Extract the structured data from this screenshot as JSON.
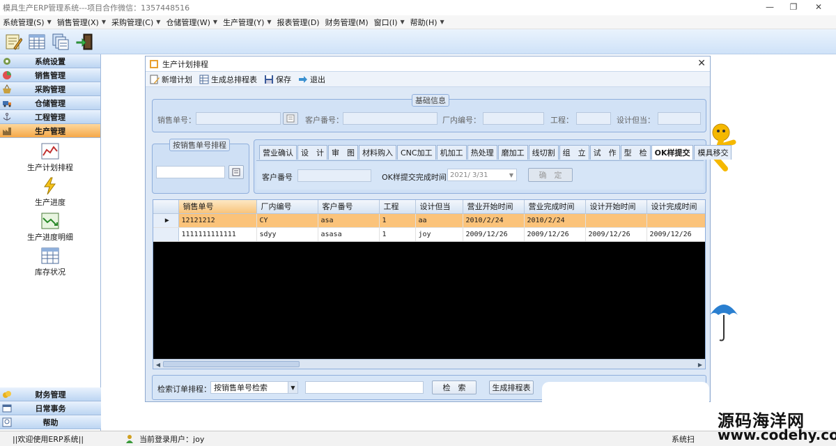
{
  "window": {
    "title": "模具生产ERP管理系统---项目合作微信：13574485​16",
    "controls": {
      "minimize": "—",
      "maximize": "❐",
      "close": "✕"
    }
  },
  "menu": [
    "系统管理(S)",
    "销售管理(X)",
    "采购管理(C)",
    "仓储管理(W)",
    "生产管理(Y)",
    "报表管理(D)",
    "财务管理(M)",
    "窗口(I)",
    "帮助(H)"
  ],
  "sidebar": {
    "top_sections": [
      {
        "label": "系统设置",
        "icon": "gear-icon"
      },
      {
        "label": "销售管理",
        "icon": "chart-icon"
      },
      {
        "label": "采购管理",
        "icon": "basket-icon"
      },
      {
        "label": "仓储管理",
        "icon": "truck-icon"
      },
      {
        "label": "工程管理",
        "icon": "anchor-icon"
      },
      {
        "label": "生产管理",
        "icon": "factory-icon",
        "active": true
      }
    ],
    "sub_items": [
      {
        "label": "生产计划排程",
        "icon": "line-chart-icon"
      },
      {
        "label": "生产进度",
        "icon": "lightning-icon"
      },
      {
        "label": "生产进度明细",
        "icon": "trend-icon"
      },
      {
        "label": "库存状况",
        "icon": "table-icon"
      }
    ],
    "bottom_sections": [
      {
        "label": "财务管理",
        "icon": "coins-icon"
      },
      {
        "label": "日常事务",
        "icon": "window-icon"
      },
      {
        "label": "帮助",
        "icon": "help-icon"
      }
    ]
  },
  "dialog": {
    "title": "生产计划排程",
    "close": "✕",
    "tools": [
      {
        "label": "新增计划",
        "icon": "edit-icon"
      },
      {
        "label": "生成总排程表",
        "icon": "table-icon"
      },
      {
        "label": "保存",
        "icon": "save-icon"
      },
      {
        "label": "退出",
        "icon": "exit-arrow-icon"
      }
    ],
    "basic_info": {
      "title": "基础信息",
      "sales_no_label": "销售单号：",
      "customer_no_label": "客户番号：",
      "factory_no_label": "厂内编号：",
      "process_label": "工程：",
      "designer_label": "设计但当："
    },
    "sales_sort": {
      "title": "按销售单号排程"
    },
    "tabs": [
      "营业确认",
      "设　计",
      "审　图",
      "材料购入",
      "CNC加工",
      "机加工",
      "热处理",
      "磨加工",
      "线切割",
      "组　立",
      "试　作",
      "型　检",
      "OK样提交",
      "模具移交"
    ],
    "active_tab": "OK样提交",
    "tab_panel": {
      "customer_no_label": "客户番号",
      "ok_time_label": "OK样提交完成时间",
      "date_value": "2021/ 3/31",
      "confirm": "确　定"
    },
    "grid": {
      "columns": [
        "销售单号",
        "厂内编号",
        "客户番号",
        "工程",
        "设计但当",
        "营业开始时间",
        "营业完成时间",
        "设计开始时间",
        "设计完成时间"
      ],
      "rows": [
        [
          "12121212",
          "CY",
          "asa",
          "1",
          "aa",
          "2010/2/24",
          "2010/2/24",
          "",
          ""
        ],
        [
          "1111111111111",
          "sdyy",
          "asasa",
          "1",
          "joy",
          "2009/12/26",
          "2009/12/26",
          "2009/12/26",
          "2009/12/26"
        ]
      ],
      "row_marker": "▶"
    },
    "search": {
      "label": "检索订单排程：",
      "select_value": "按销售单号检索",
      "search_button": "检　索",
      "generate_button": "生成排程表"
    }
  },
  "status": {
    "welcome": "||欢迎使用ERP系统||",
    "user_label": "当前登录用户：joy",
    "right_text": "系统扫"
  },
  "watermark": {
    "line1": "源码海洋网",
    "line2": "www.codehy.com"
  }
}
